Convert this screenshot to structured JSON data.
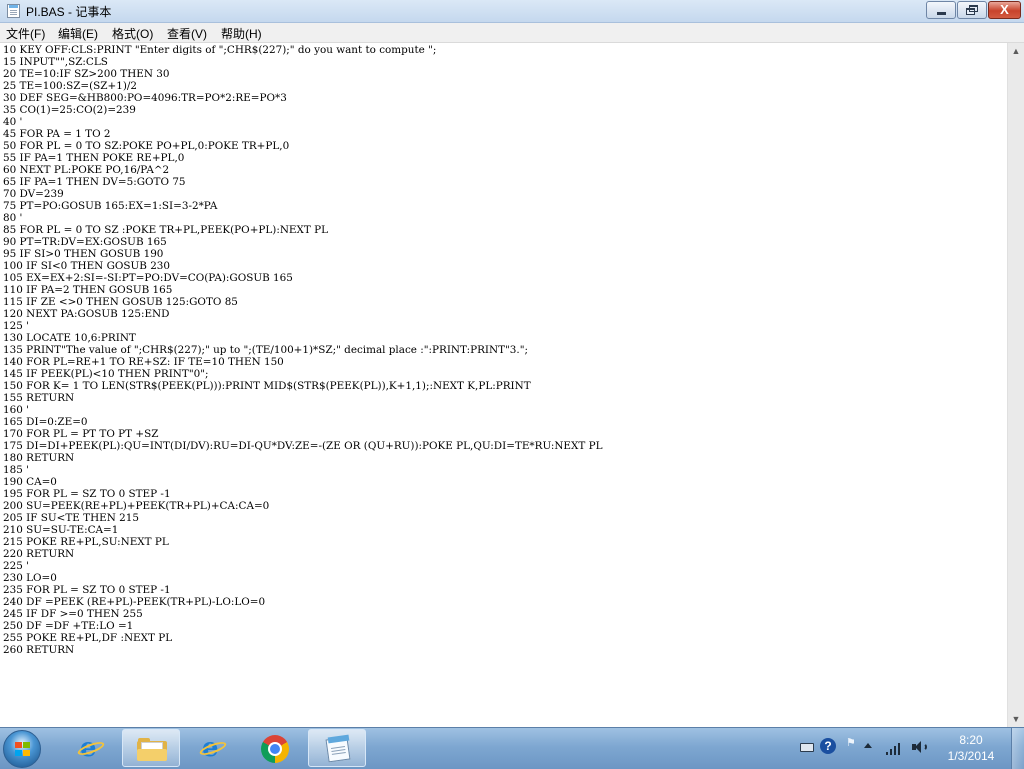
{
  "window": {
    "title": "PI.BAS - 记事本",
    "buttons": {
      "minimize": "minimize",
      "maximize": "restore",
      "close": "X"
    }
  },
  "menu": {
    "items": [
      {
        "label": "文件(F)"
      },
      {
        "label": "编辑(E)"
      },
      {
        "label": "格式(O)"
      },
      {
        "label": "查看(V)"
      },
      {
        "label": "帮助(H)"
      }
    ]
  },
  "editor": {
    "lines": [
      "10 KEY OFF:CLS:PRINT \"Enter digits of \";CHR$(227);\" do you want to compute \";",
      "15 INPUT\"\",SZ:CLS",
      "20 TE=10:IF SZ>200 THEN 30",
      "25 TE=100:SZ=(SZ+1)/2",
      "30 DEF SEG=&HB800:PO=4096:TR=PO*2:RE=PO*3",
      "35 CO(1)=25:CO(2)=239",
      "40 '",
      "45 FOR PA = 1 TO 2",
      "50 FOR PL = 0 TO SZ:POKE PO+PL,0:POKE TR+PL,0",
      "55 IF PA=1 THEN POKE RE+PL,0",
      "60 NEXT PL:POKE PO,16/PA^2",
      "65 IF PA=1 THEN DV=5:GOTO 75",
      "70 DV=239",
      "75 PT=PO:GOSUB 165:EX=1:SI=3-2*PA",
      "80 '",
      "85 FOR PL = 0 TO SZ :POKE TR+PL,PEEK(PO+PL):NEXT PL",
      "90 PT=TR:DV=EX:GOSUB 165",
      "95 IF SI>0 THEN GOSUB 190",
      "100 IF SI<0 THEN GOSUB 230",
      "105 EX=EX+2:SI=-SI:PT=PO:DV=CO(PA):GOSUB 165",
      "110 IF PA=2 THEN GOSUB 165",
      "115 IF ZE <>0 THEN GOSUB 125:GOTO 85",
      "120 NEXT PA:GOSUB 125:END",
      "125 '",
      "130 LOCATE 10,6:PRINT",
      "135 PRINT\"The value of \";CHR$(227);\" up to \";(TE/100+1)*SZ;\" decimal place :\":PRINT:PRINT\"3.\";",
      "140 FOR PL=RE+1 TO RE+SZ: IF TE=10 THEN 150",
      "145 IF PEEK(PL)<10 THEN PRINT\"0\";",
      "150 FOR K= 1 TO LEN(STR$(PEEK(PL))):PRINT MID$(STR$(PEEK(PL)),K+1,1);:NEXT K,PL:PRINT",
      "155 RETURN",
      "160 '",
      "165 DI=0:ZE=0",
      "170 FOR PL = PT TO PT +SZ",
      "175 DI=DI+PEEK(PL):QU=INT(DI/DV):RU=DI-QU*DV:ZE=-(ZE OR (QU+RU)):POKE PL,QU:DI=TE*RU:NEXT PL",
      "180 RETURN",
      "185 '",
      "190 CA=0",
      "195 FOR PL = SZ TO 0 STEP -1",
      "200 SU=PEEK(RE+PL)+PEEK(TR+PL)+CA:CA=0",
      "205 IF SU<TE THEN 215",
      "210 SU=SU-TE:CA=1",
      "215 POKE RE+PL,SU:NEXT PL",
      "220 RETURN",
      "225 '",
      "230 LO=0",
      "235 FOR PL = SZ TO 0 STEP -1",
      "240 DF =PEEK (RE+PL)-PEEK(TR+PL)-LO:LO=0",
      "245 IF DF >=0 THEN 255",
      "250 DF =DF +TE:LO =1",
      "255 POKE RE+PL,DF :NEXT PL",
      "260 RETURN"
    ]
  },
  "taskbar": {
    "buttons": [
      {
        "name": "internet-explorer",
        "icon": "ie-icon"
      },
      {
        "name": "file-explorer",
        "icon": "folder-icon",
        "active": true
      },
      {
        "name": "internet-explorer-2",
        "icon": "ie-icon"
      },
      {
        "name": "chrome",
        "icon": "chrome-icon"
      },
      {
        "name": "notepad",
        "icon": "notepad-icon",
        "active": true
      }
    ],
    "clock": {
      "time": "8:20",
      "date": "1/3/2014"
    }
  },
  "colors": {
    "titlebar": "#c5d8ee",
    "close_button": "#c8432c",
    "taskbar": "#7ea7d1",
    "editor_bg": "#ffffff"
  }
}
